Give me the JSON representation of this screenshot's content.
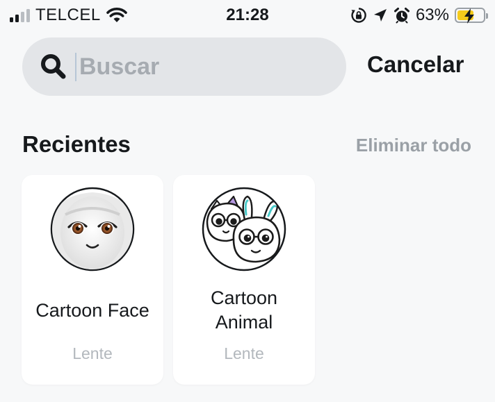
{
  "status_bar": {
    "carrier": "TELCEL",
    "time": "21:28",
    "battery_percent": "63%",
    "battery_level": 0.63,
    "signal_bars_active": 2,
    "signal_bars_total": 4,
    "icons": [
      "signal-icon",
      "wifi-icon",
      "rotation-lock-icon",
      "location-arrow-icon",
      "alarm-icon",
      "battery-icon",
      "charging-bolt-icon"
    ]
  },
  "search": {
    "placeholder": "Buscar",
    "value": "",
    "cancel_label": "Cancelar"
  },
  "recents": {
    "title": "Recientes",
    "clear_all_label": "Eliminar todo",
    "items": [
      {
        "title_lines": [
          "Cartoon Face"
        ],
        "type": "Lente",
        "thumbnail": "cartoon-face-icon"
      },
      {
        "title_lines": [
          "Cartoon",
          "Animal"
        ],
        "type": "Lente",
        "thumbnail": "cartoon-animal-icon"
      }
    ]
  },
  "colors": {
    "background": "#f7f8f9",
    "search_field": "#e3e5e8",
    "text_primary": "#16191c",
    "text_secondary": "#9aa0a6",
    "battery_fill": "#f5cb1b",
    "card": "#ffffff"
  }
}
